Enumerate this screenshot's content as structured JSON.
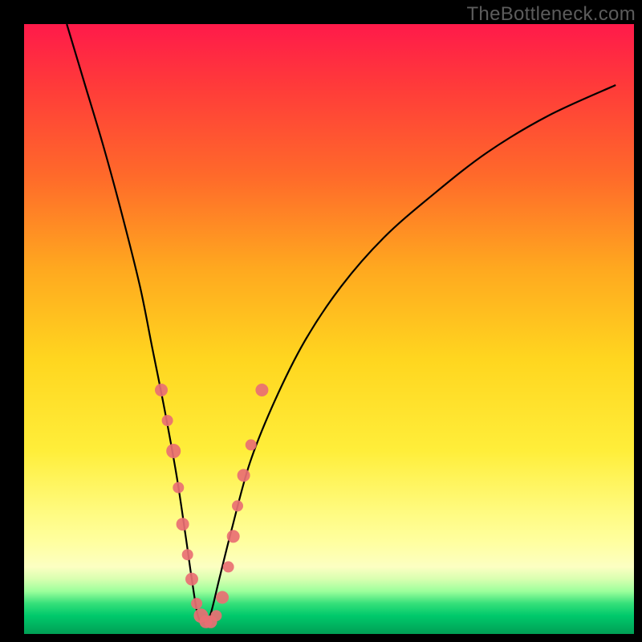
{
  "watermark": "TheBottleneck.com",
  "colors": {
    "curve_stroke": "#000000",
    "marker_fill": "#e96f73",
    "marker_stroke": "#e96f73"
  },
  "chart_data": {
    "type": "line",
    "title": "",
    "xlabel": "",
    "ylabel": "",
    "xlim": [
      0,
      100
    ],
    "ylim": [
      0,
      100
    ],
    "series": [
      {
        "name": "bottleneck-curve",
        "x": [
          7,
          10,
          13,
          16,
          19,
          21,
          23,
          25,
          26.5,
          27.5,
          28.5,
          29.5,
          30.5,
          32,
          34,
          37,
          41,
          46,
          52,
          59,
          67,
          76,
          86,
          97
        ],
        "y": [
          100,
          90,
          80,
          69,
          57,
          47,
          37,
          26,
          16,
          9,
          3,
          2,
          3,
          9,
          17,
          28,
          38,
          48,
          57,
          65,
          72,
          79,
          85,
          90
        ]
      }
    ],
    "markers": [
      {
        "x": 22.5,
        "y": 40,
        "r": 8
      },
      {
        "x": 23.5,
        "y": 35,
        "r": 7
      },
      {
        "x": 24.5,
        "y": 30,
        "r": 9
      },
      {
        "x": 25.3,
        "y": 24,
        "r": 7
      },
      {
        "x": 26.0,
        "y": 18,
        "r": 8
      },
      {
        "x": 26.8,
        "y": 13,
        "r": 7
      },
      {
        "x": 27.5,
        "y": 9,
        "r": 8
      },
      {
        "x": 28.3,
        "y": 5,
        "r": 7
      },
      {
        "x": 29.0,
        "y": 3,
        "r": 9
      },
      {
        "x": 29.8,
        "y": 2,
        "r": 8
      },
      {
        "x": 30.6,
        "y": 2,
        "r": 8
      },
      {
        "x": 31.5,
        "y": 3,
        "r": 7
      },
      {
        "x": 32.5,
        "y": 6,
        "r": 8
      },
      {
        "x": 33.5,
        "y": 11,
        "r": 7
      },
      {
        "x": 34.3,
        "y": 16,
        "r": 8
      },
      {
        "x": 35.0,
        "y": 21,
        "r": 7
      },
      {
        "x": 36.0,
        "y": 26,
        "r": 8
      },
      {
        "x": 37.2,
        "y": 31,
        "r": 7
      },
      {
        "x": 39.0,
        "y": 40,
        "r": 8
      }
    ]
  }
}
